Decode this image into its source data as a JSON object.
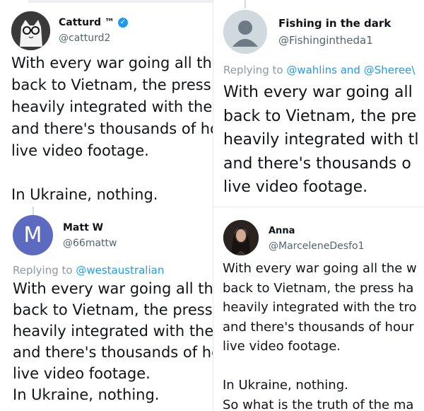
{
  "tweets": [
    {
      "name": "Catturd ™",
      "handle": "@catturd2",
      "verified": true,
      "lines": [
        "With every war going all the",
        "back to Vietnam, the press l",
        "heavily integrated with the t",
        "and there's thousands of ho",
        "live video footage.",
        "",
        "In Ukraine, nothing."
      ]
    },
    {
      "name": "Fishing in the dark",
      "handle": "@Fishingintheda1",
      "reply_prefix": "Replying to ",
      "reply_mentions": "@wahlins and @Sheree\\",
      "lines": [
        "With every war going all",
        "back to Vietnam, the pre",
        "heavily integrated with tl",
        "and there's thousands o",
        "live video footage."
      ]
    },
    {
      "name": "Matt W",
      "handle": "@66mattw",
      "avatar_letter": "M",
      "reply_prefix": "Replying to ",
      "reply_mentions": "@westaustralian",
      "lines": [
        "With every war going all the",
        "back to Vietnam, the press",
        "heavily integrated with the",
        "and there's thousands of he",
        "live video footage.",
        "In Ukraine, nothing."
      ]
    },
    {
      "name": "Anna",
      "handle": "@MarceleneDesfo1",
      "lines": [
        "With every war going all the w",
        "back to Vietnam, the press ha",
        "heavily integrated with the tro",
        "and there's thousands of hour",
        "live video footage.",
        "",
        "In Ukraine, nothing.",
        "So what is the truth of the ma"
      ]
    }
  ],
  "colors": {
    "accent": "#1d9bf0",
    "matt_avatar": "#5c6bc0",
    "secondary_text": "#536471"
  }
}
